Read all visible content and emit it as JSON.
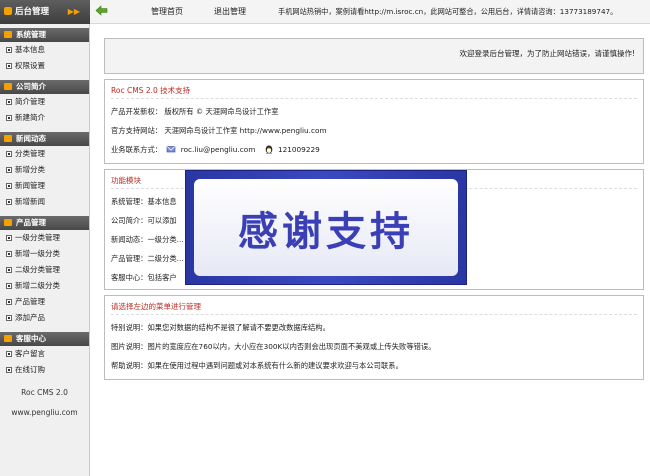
{
  "header": {
    "brand": "后台管理",
    "brand_arrows": "▶▶",
    "nav": [
      "管理首页",
      "退出管理"
    ],
    "notice": "手机网站热销中，案例请看http://m.isroc.cn，此网站可整合，公用后台，详情请咨询：13773189747。"
  },
  "sidebar": {
    "sections": [
      {
        "title": "系统管理",
        "items": [
          "基本信息",
          "权限设置"
        ]
      },
      {
        "title": "公司简介",
        "items": [
          "简介管理",
          "新建简介"
        ]
      },
      {
        "title": "新闻动态",
        "items": [
          "分类管理",
          "新增分类",
          "新闻管理",
          "新增新闻"
        ]
      },
      {
        "title": "产品管理",
        "items": [
          "一级分类管理",
          "新增一级分类",
          "二级分类管理",
          "新增二级分类",
          "产品管理",
          "添加产品"
        ]
      },
      {
        "title": "客服中心",
        "items": [
          "客户留言",
          "在线订购"
        ]
      }
    ],
    "footer": [
      "Roc CMS 2.0",
      "www.pengliu.com"
    ]
  },
  "main": {
    "welcome": "欢迎登录后台管理，为了防止网站错误，请谨慎操作!",
    "support": {
      "title": "Roc CMS 2.0 技术支持",
      "rows": [
        "产品开发新权：  版权所有 © 天涯网命鸟设计工作室",
        "官方支持网站：  天涯网命鸟设计工作室 http://www.pengliu.com"
      ],
      "contact_label": "业务联系方式：",
      "email": "roc.liu@pengliu.com",
      "qq": "121009229"
    },
    "modules": {
      "title": "功能模块",
      "rows": [
        "系统管理：基本信息",
        "公司简介：可以添加",
        "新闻动态：一级分类...",
        "产品管理：二级分类...",
        "客服中心：包括客户"
      ]
    },
    "instructions": {
      "title": "请选择左边的菜单进行管理",
      "rows": [
        "特别说明：如果您对数据的结构不是很了解请不要更改数据库结构。",
        "图片说明：图片的宽度应在760以内，大小应在300K以内否则会出现页面不美观或上传失败等错误。",
        "帮助说明：如果在使用过程中遇到问题或对本系统有什么新的建议要求欢迎与本公司联系。"
      ]
    }
  },
  "overlay": {
    "text": "感谢支持"
  },
  "colors": {
    "accent": "#c0281f",
    "brand_orange": "#f2a100",
    "banner_blue": "#3b3fb5"
  }
}
